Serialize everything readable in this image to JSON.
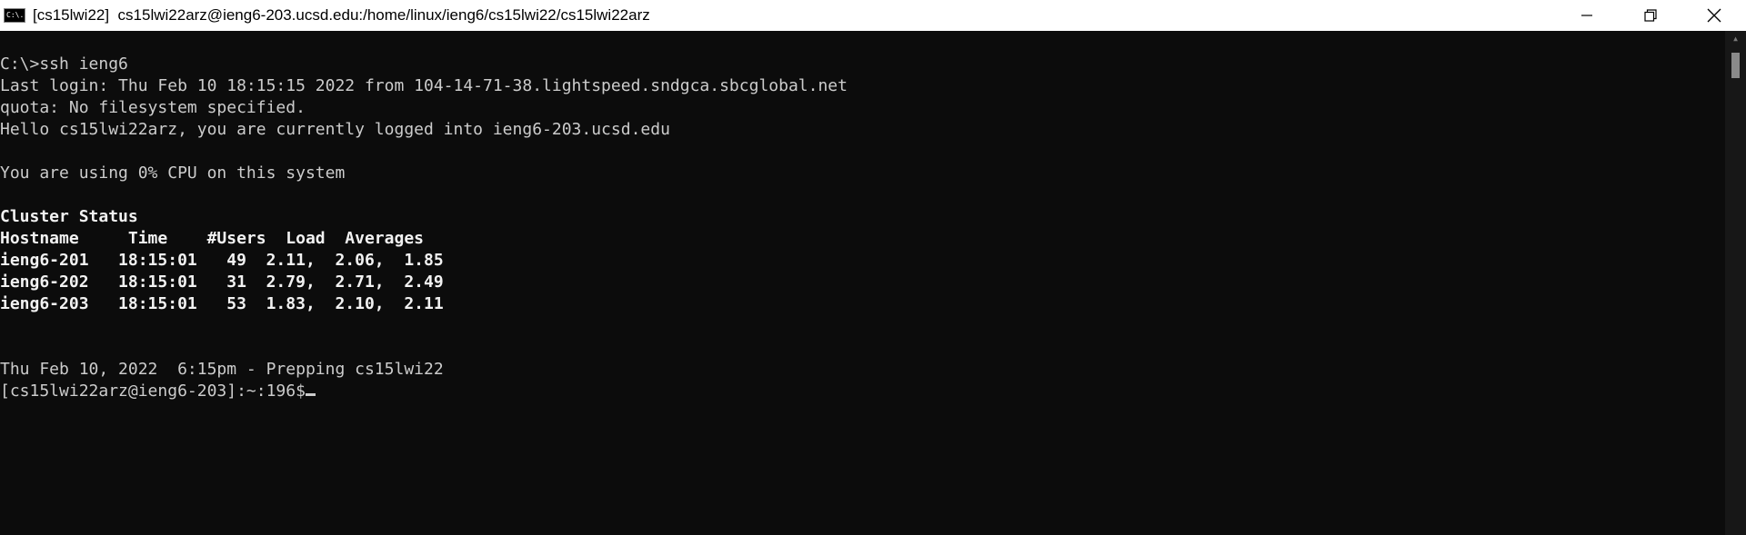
{
  "window": {
    "title": "[cs15lwi22]  cs15lwi22arz@ieng6-203.ucsd.edu:/home/linux/ieng6/cs15lwi22/cs15lwi22arz",
    "app_icon_label": "C:\\."
  },
  "terminal": {
    "lines": [
      {
        "text": "C:\\>ssh ieng6",
        "bold": false
      },
      {
        "text": "Last login: Thu Feb 10 18:15:15 2022 from 104-14-71-38.lightspeed.sndgca.sbcglobal.net",
        "bold": false
      },
      {
        "text": "quota: No filesystem specified.",
        "bold": false
      },
      {
        "text": "Hello cs15lwi22arz, you are currently logged into ieng6-203.ucsd.edu",
        "bold": false
      },
      {
        "text": "",
        "bold": false
      },
      {
        "text": "You are using 0% CPU on this system",
        "bold": false
      },
      {
        "text": "",
        "bold": false
      },
      {
        "text": "Cluster Status",
        "bold": true
      },
      {
        "text": "Hostname     Time    #Users  Load  Averages",
        "bold": true
      },
      {
        "text": "ieng6-201   18:15:01   49  2.11,  2.06,  1.85",
        "bold": true
      },
      {
        "text": "ieng6-202   18:15:01   31  2.79,  2.71,  2.49",
        "bold": true
      },
      {
        "text": "ieng6-203   18:15:01   53  1.83,  2.10,  2.11",
        "bold": true
      },
      {
        "text": "",
        "bold": false
      },
      {
        "text": "",
        "bold": false
      },
      {
        "text": "Thu Feb 10, 2022  6:15pm - Prepping cs15lwi22",
        "bold": false
      },
      {
        "text": "[cs15lwi22arz@ieng6-203]:~:196$",
        "bold": false,
        "prompt": true
      }
    ]
  }
}
